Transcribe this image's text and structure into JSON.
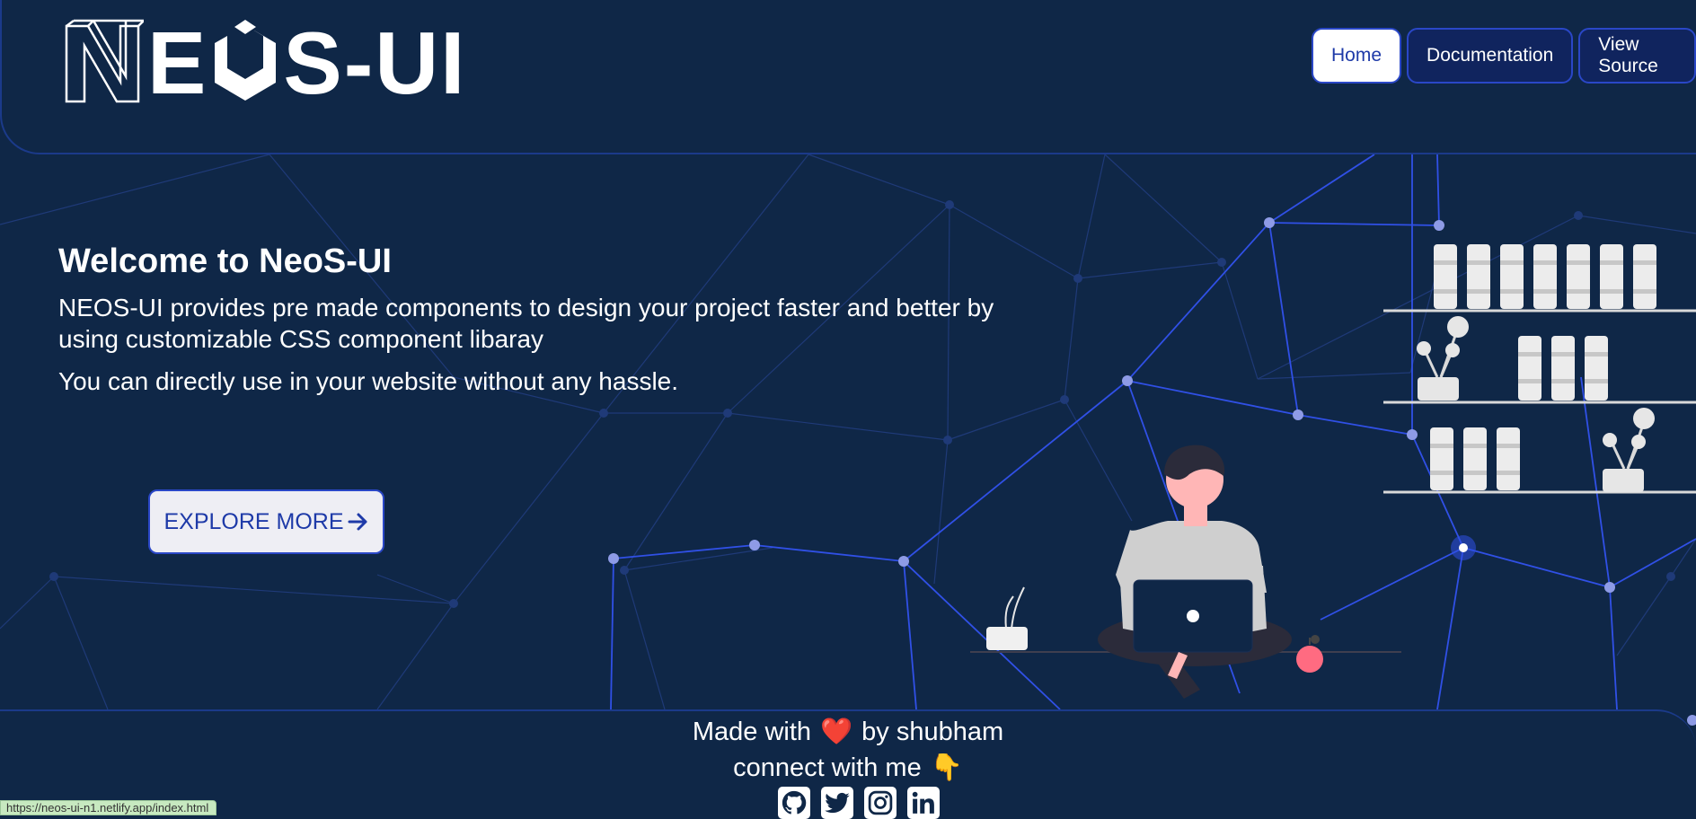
{
  "brand": {
    "logo_text_pre": "E",
    "logo_text_post": "S-UI",
    "logo_name": "NEOS-UI"
  },
  "nav": {
    "items": [
      {
        "label": "Home",
        "active": true
      },
      {
        "label": "Documentation",
        "active": false
      },
      {
        "label": "View Source",
        "active": false
      }
    ]
  },
  "hero": {
    "title": "Welcome to NeoS-UI",
    "description": "NEOS-UI provides pre made components to design your project faster and better by using customizable CSS component libaray",
    "subtext": "You can directly use in your website without any hassle.",
    "cta_label": "EXPLORE MORE"
  },
  "footer": {
    "made_with_prefix": "Made with",
    "made_with_suffix": "by shubham",
    "connect_text": "connect with me",
    "heart_emoji": "❤️",
    "point_emoji": "👇",
    "socials": [
      "github-icon",
      "twitter-icon",
      "instagram-icon",
      "linkedin-icon"
    ]
  },
  "status_bar": {
    "url": "https://neos-ui-n1.netlify.app/index.html"
  },
  "colors": {
    "background": "#0f2747",
    "accent": "#2a47c7",
    "network_line": "#2f4fe0",
    "node": "#8e9be6"
  }
}
